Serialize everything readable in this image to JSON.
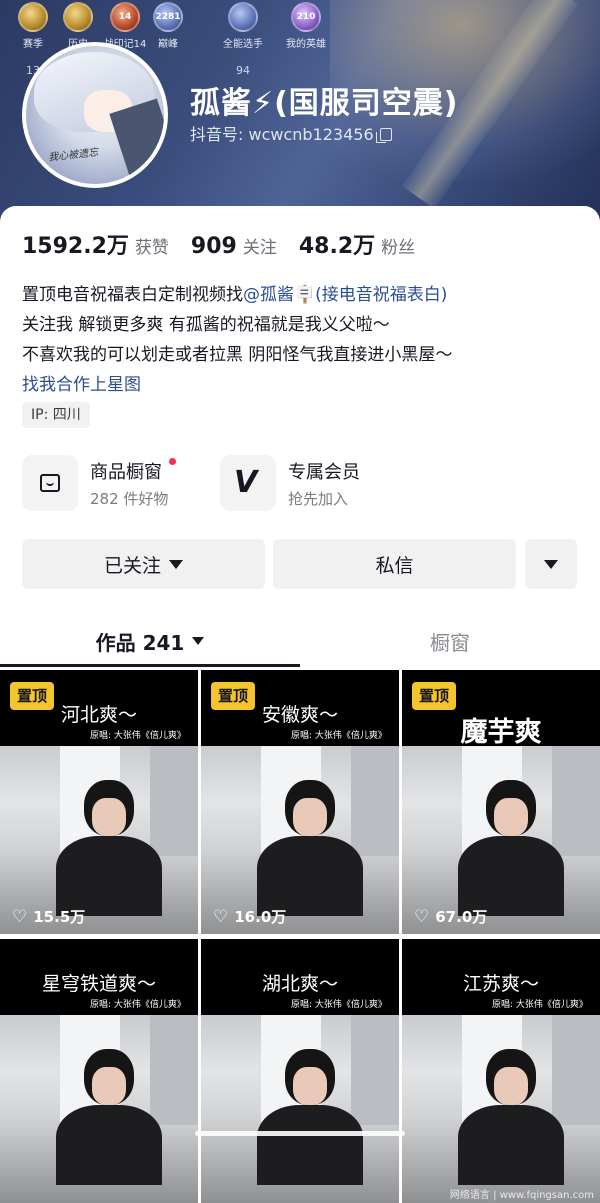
{
  "header": {
    "ranks": [
      {
        "label": "赛季",
        "num": "13",
        "style": "gold",
        "badge": ""
      },
      {
        "label": "历史",
        "num": "",
        "style": "gold",
        "badge": ""
      },
      {
        "label": "战印记14",
        "num": "",
        "style": "red",
        "badge": "14"
      },
      {
        "label": "巅峰",
        "num": "",
        "style": "blue",
        "badge": "2281"
      },
      {
        "label": "全能选手",
        "num": "94",
        "style": "blue",
        "badge": ""
      },
      {
        "label": "我的英雄",
        "num": "",
        "style": "purple",
        "badge": "210"
      }
    ],
    "nickname": "孤酱⚡(国服司空震)",
    "douyin_id": "抖音号: wcwcnb123456",
    "avatar_signature": "我心被遗忘"
  },
  "stats": [
    {
      "value": "1592.2万",
      "label": "获赞"
    },
    {
      "value": "909",
      "label": "关注"
    },
    {
      "value": "48.2万",
      "label": "粉丝"
    }
  ],
  "bio": {
    "line1_prefix": "置顶电音祝福表白定制视频找",
    "line1_mention": "@孤酱🪧(接电音祝福表白)",
    "line2": "关注我 解锁更多爽 有孤酱的祝福就是我义父啦～",
    "line3": "不喜欢我的可以划走或者拉黑 阴阳怪气我直接进小黑屋～",
    "line4_link": "找我合作上星图"
  },
  "ip_tag": "IP: 四川",
  "services": [
    {
      "title": "商品橱窗",
      "subtitle": "282 件好物"
    },
    {
      "title": "专属会员",
      "subtitle": "抢先加入"
    }
  ],
  "actions": {
    "follow": "已关注",
    "message": "私信"
  },
  "tabs": {
    "works": "作品 241",
    "shop": "橱窗"
  },
  "videos": [
    {
      "pinned": "置顶",
      "title": "河北爽～",
      "source": "原唱: 大张伟《倍儿爽》",
      "likes": "15.5万"
    },
    {
      "pinned": "置顶",
      "title": "安徽爽～",
      "source": "原唱: 大张伟《倍儿爽》",
      "likes": "16.0万"
    },
    {
      "pinned": "置顶",
      "title": "魔芋爽",
      "source": "",
      "likes": "67.0万"
    },
    {
      "pinned": "",
      "title": "星穹铁道爽～",
      "source": "原唱: 大张伟《倍儿爽》",
      "likes": ""
    },
    {
      "pinned": "",
      "title": "湖北爽～",
      "source": "原唱: 大张伟《倍儿爽》",
      "likes": ""
    },
    {
      "pinned": "",
      "title": "江苏爽～",
      "source": "原唱: 大张伟《倍儿爽》",
      "likes": ""
    }
  ],
  "watermark": "网络语言 | www.fqingsan.com",
  "colors": {
    "accent": "#fe2c55",
    "pin": "#f5c32d",
    "mention": "#2a4d94"
  }
}
